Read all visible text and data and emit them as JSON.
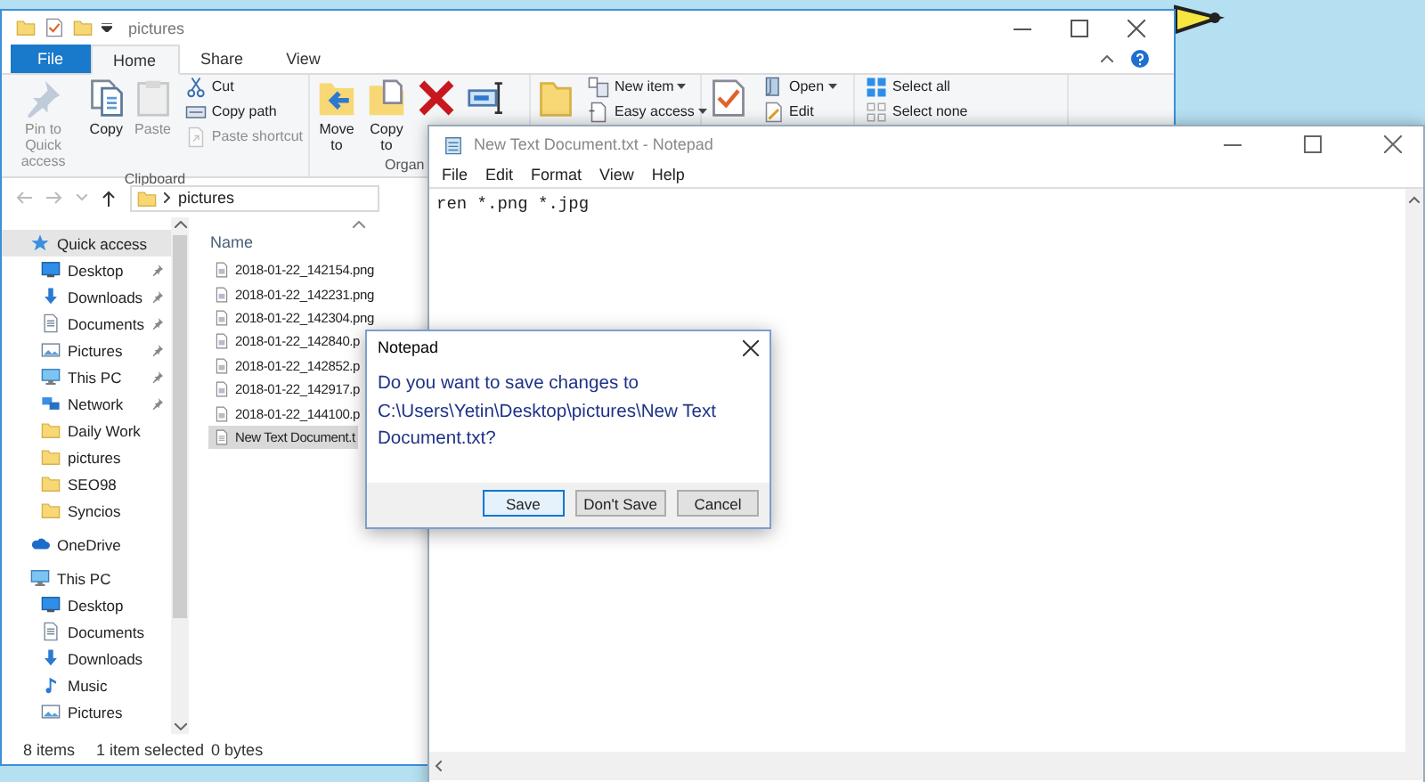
{
  "explorer": {
    "title": "pictures",
    "tabs": [
      {
        "label": "File",
        "kind": "file",
        "selected": false
      },
      {
        "label": "Home",
        "kind": "tab",
        "selected": true
      },
      {
        "label": "Share",
        "kind": "tab",
        "selected": false
      },
      {
        "label": "View",
        "kind": "tab",
        "selected": false
      }
    ],
    "ribbon": [
      {
        "label": "Clipboard",
        "large": [
          {
            "kind": "pin",
            "label": "Pin to Quick access",
            "disabled": true
          },
          {
            "kind": "copy",
            "label": "Copy",
            "disabled": false
          },
          {
            "kind": "paste",
            "label": "Paste",
            "disabled": true
          }
        ],
        "small": [
          {
            "kind": "cut",
            "label": "Cut",
            "disabled": false,
            "menu": false
          },
          {
            "kind": "copypath",
            "label": "Copy path",
            "disabled": false,
            "menu": false
          },
          {
            "kind": "pasteshortcut",
            "label": "Paste shortcut",
            "disabled": true,
            "menu": false
          }
        ]
      },
      {
        "label": "Organ",
        "large": [
          {
            "kind": "moveto",
            "label": "Move to",
            "disabled": false
          },
          {
            "kind": "copyto",
            "label": "Copy to",
            "disabled": false
          },
          {
            "kind": "delete",
            "disabled": false
          },
          {
            "kind": "rename",
            "disabled": false
          }
        ]
      },
      {
        "large": [
          {
            "kind": "newfolder",
            "disabled": false
          }
        ],
        "small": [
          {
            "kind": "newitem",
            "label": "New item",
            "disabled": false,
            "menu": true
          },
          {
            "kind": "easyaccess",
            "label": "Easy access",
            "disabled": false,
            "menu": true
          }
        ]
      },
      {
        "large": [
          {
            "kind": "properties",
            "disabled": false
          }
        ],
        "small": [
          {
            "kind": "open",
            "label": "Open",
            "disabled": false,
            "menu": true
          },
          {
            "kind": "edit",
            "label": "Edit",
            "disabled": false,
            "menu": false
          }
        ]
      },
      {
        "small": [
          {
            "kind": "selectall",
            "label": "Select all",
            "disabled": false,
            "menu": false
          },
          {
            "kind": "selectnone",
            "label": "Select none",
            "disabled": false,
            "menu": false
          }
        ]
      }
    ],
    "address": "pictures",
    "nav": [
      {
        "label": "Quick access",
        "kind": "star",
        "selected": true,
        "children": [
          {
            "label": "Desktop",
            "kind": "desktop",
            "selected": false,
            "pinned": true
          },
          {
            "label": "Downloads",
            "kind": "download",
            "selected": false,
            "pinned": true
          },
          {
            "label": "Documents",
            "kind": "documents",
            "selected": false,
            "pinned": true
          },
          {
            "label": "Pictures",
            "kind": "pictures",
            "selected": false,
            "pinned": true
          },
          {
            "label": "This PC",
            "kind": "pc",
            "selected": false,
            "pinned": true
          },
          {
            "label": "Network",
            "kind": "network",
            "selected": false,
            "pinned": true
          },
          {
            "label": "Daily Work",
            "kind": "folder",
            "selected": false,
            "pinned": false
          },
          {
            "label": "pictures",
            "kind": "folder",
            "selected": false,
            "pinned": false
          },
          {
            "label": "SEO98",
            "kind": "folder",
            "selected": false,
            "pinned": false
          },
          {
            "label": "Syncios",
            "kind": "folder",
            "selected": false,
            "pinned": false
          }
        ]
      },
      {
        "label": "OneDrive",
        "kind": "cloud",
        "selected": false
      },
      {
        "label": "This PC",
        "kind": "pc",
        "selected": false,
        "children": [
          {
            "label": "Desktop",
            "kind": "desktop",
            "selected": false
          },
          {
            "label": "Documents",
            "kind": "documents",
            "selected": false
          },
          {
            "label": "Downloads",
            "kind": "download",
            "selected": false
          },
          {
            "label": "Music",
            "kind": "music",
            "selected": false
          },
          {
            "label": "Pictures",
            "kind": "pictures",
            "selected": false
          }
        ]
      }
    ],
    "column": "Name",
    "files": [
      {
        "name": "2018-01-22_142154.png",
        "kind": "image",
        "selected": false
      },
      {
        "name": "2018-01-22_142231.png",
        "kind": "image",
        "selected": false
      },
      {
        "name": "2018-01-22_142304.png",
        "kind": "image",
        "selected": false
      },
      {
        "name": "2018-01-22_142840.p",
        "kind": "image",
        "selected": false
      },
      {
        "name": "2018-01-22_142852.p",
        "kind": "image",
        "selected": false
      },
      {
        "name": "2018-01-22_142917.p",
        "kind": "image",
        "selected": false
      },
      {
        "name": "2018-01-22_144100.p",
        "kind": "image",
        "selected": false
      },
      {
        "name": "New Text Document.t",
        "kind": "text",
        "selected": true
      }
    ],
    "status": {
      "count": "8 items",
      "selection": "1 item selected",
      "size": "0 bytes"
    }
  },
  "notepad": {
    "title": "New Text Document.txt - Notepad",
    "menu": [
      "File",
      "Edit",
      "Format",
      "View",
      "Help"
    ],
    "text": "ren *.png *.jpg"
  },
  "dialog": {
    "title": "Notepad",
    "message": "Do you want to save changes to C:\\Users\\Yetin\\Desktop\\pictures\\New Text Document.txt?",
    "buttons": [
      {
        "label": "Save",
        "default": true
      },
      {
        "label": "Don't Save",
        "default": false
      },
      {
        "label": "Cancel",
        "default": false
      }
    ]
  }
}
